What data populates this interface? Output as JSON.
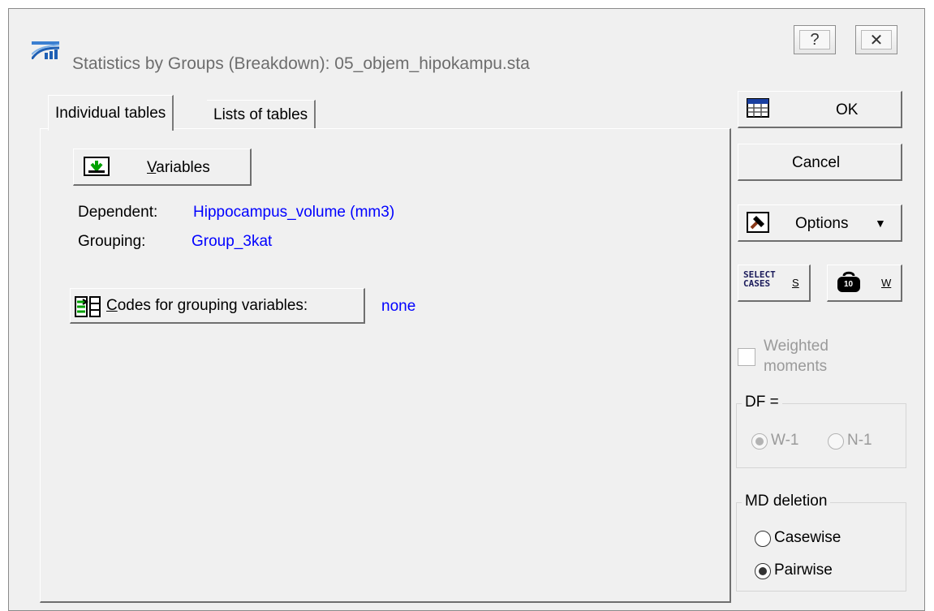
{
  "window": {
    "title": "Statistics by Groups (Breakdown): 05_objem_hipokampu.sta",
    "help_symbol": "?",
    "close_symbol": "✕"
  },
  "tabs": [
    {
      "label": "Individual tables"
    },
    {
      "label": "Lists of tables"
    }
  ],
  "panel": {
    "variables_button": {
      "accel": "V",
      "rest": "ariables"
    },
    "dependent_label": "Dependent:",
    "dependent_value": "Hippocampus_volume (mm3)",
    "grouping_label": "Grouping:",
    "grouping_value": "Group_3kat",
    "codes_button": {
      "accel": "C",
      "rest": "odes for grouping variables:"
    },
    "codes_value": "none"
  },
  "side": {
    "ok_label": "OK",
    "cancel_label": "Cancel",
    "options_label": "Options",
    "options_arrow": "▼",
    "select_cases_icon_text": "SELECT CASES",
    "select_cases_key": "S",
    "weight_key": "W",
    "weight_icon_text": "10",
    "weighted_label_line1": "Weighted",
    "weighted_label_line2": "moments",
    "df_group_label": "DF =",
    "df_options": [
      {
        "label": "W-1",
        "selected": true
      },
      {
        "label": "N-1",
        "selected": false
      }
    ],
    "md_group_label": "MD deletion",
    "md_options": [
      {
        "label": "Casewise",
        "selected": false
      },
      {
        "label": "Pairwise",
        "selected": true
      }
    ]
  },
  "colors": {
    "value_text": "#0000ff",
    "disabled_text": "#9a9a9a",
    "dialog_bg": "#f0f0f0"
  }
}
